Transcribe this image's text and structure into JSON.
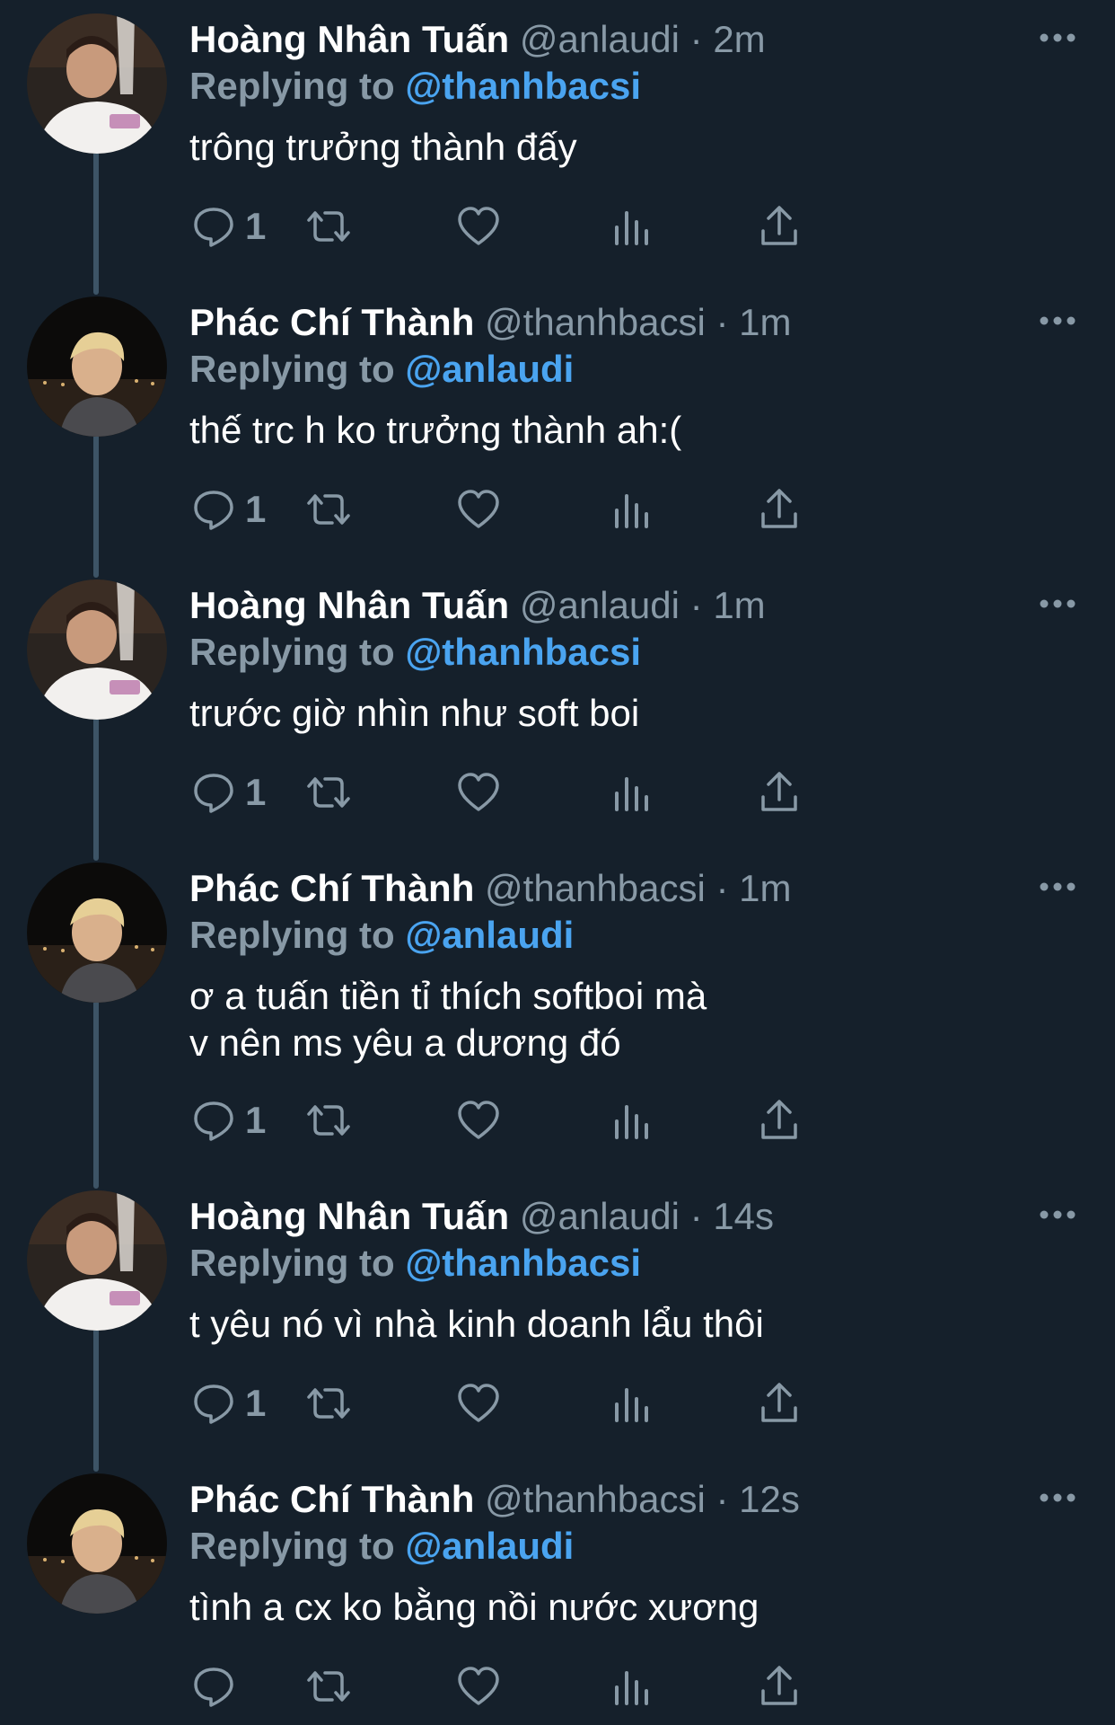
{
  "theme": {
    "background": "#15202b",
    "primary_text": "#ffffff",
    "secondary_text": "#8899a6",
    "accent": "#4aa4f0",
    "thread_line": "#3d5466"
  },
  "users": {
    "anlaudi": {
      "name": "Hoàng Nhân Tuấn",
      "handle": "@anlaudi"
    },
    "thanhbacsi": {
      "name": "Phác Chí Thành",
      "handle": "@thanhbacsi"
    }
  },
  "reply_prefix": "Replying to",
  "separator": "·",
  "icons": {
    "reply": "reply-bubble-icon",
    "retweet": "retweet-icon",
    "like": "heart-icon",
    "analytics": "analytics-bars-icon",
    "share": "share-upload-icon",
    "more": "more-dots-icon"
  },
  "tweets": [
    {
      "author_name": "Hoàng Nhân Tuấn",
      "author_handle": "@anlaudi",
      "time": "2m",
      "reply_to": "@thanhbacsi",
      "text": "trông trưởng thành đấy",
      "reply_count": "1"
    },
    {
      "author_name": "Phác Chí Thành",
      "author_handle": "@thanhbacsi",
      "time": "1m",
      "reply_to": "@anlaudi",
      "text": "thế trc h ko trưởng thành ah:(",
      "reply_count": "1"
    },
    {
      "author_name": "Hoàng Nhân Tuấn",
      "author_handle": "@anlaudi",
      "time": "1m",
      "reply_to": "@thanhbacsi",
      "text": "trước giờ nhìn như soft boi",
      "reply_count": "1"
    },
    {
      "author_name": "Phác Chí Thành",
      "author_handle": "@thanhbacsi",
      "time": "1m",
      "reply_to": "@anlaudi",
      "text": "ơ a tuấn tiền tỉ thích softboi mà\nv nên ms yêu a dương đó",
      "reply_count": "1"
    },
    {
      "author_name": "Hoàng Nhân Tuấn",
      "author_handle": "@anlaudi",
      "time": "14s",
      "reply_to": "@thanhbacsi",
      "text": "t yêu nó vì nhà kinh doanh lẩu thôi",
      "reply_count": "1"
    },
    {
      "author_name": "Phác Chí Thành",
      "author_handle": "@thanhbacsi",
      "time": "12s",
      "reply_to": "@anlaudi",
      "text": "tình a cx ko bằng nồi nước xương",
      "reply_count": ""
    }
  ]
}
